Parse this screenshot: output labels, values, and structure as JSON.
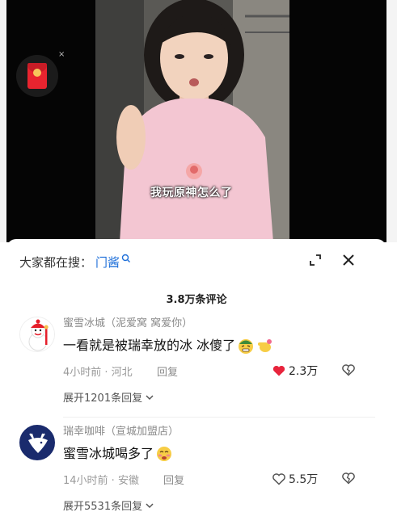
{
  "video": {
    "subtitle": "我玩原神怎么了",
    "redpacket_icon": "red-envelope-icon",
    "redpacket_close": "×"
  },
  "search": {
    "label": "大家都在搜：",
    "term": "门酱",
    "icon": "search-icon"
  },
  "panel": {
    "expand_icon": "expand-icon",
    "close_icon": "close-icon",
    "comment_count": "3.8万条评论"
  },
  "comments": [
    {
      "user": "蜜雪冰城（泥爱窝 窝爱你）",
      "text": "一看就是被瑞幸放的冰 冰傻了",
      "emojis": [
        "grimace-emoji",
        "pointing-hand-emoji"
      ],
      "time_location": "4小时前 · 河北",
      "reply_label": "回复",
      "likes": "2.3万",
      "liked": true,
      "expand_label": "展开1201条回复",
      "avatar": "snowman-avatar"
    },
    {
      "user": "瑞幸咖啡（宣城加盟店）",
      "text": "蜜雪冰城喝多了",
      "emojis": [
        "tipsy-emoji"
      ],
      "time_location": "14小时前 · 安徽",
      "reply_label": "回复",
      "likes": "5.5万",
      "liked": false,
      "expand_label": "展开5531条回复",
      "avatar": "deer-avatar"
    }
  ],
  "colors": {
    "liked_red": "#e8243c",
    "link_blue": "#1e6fd9",
    "luckin_blue": "#1a2b6d"
  }
}
